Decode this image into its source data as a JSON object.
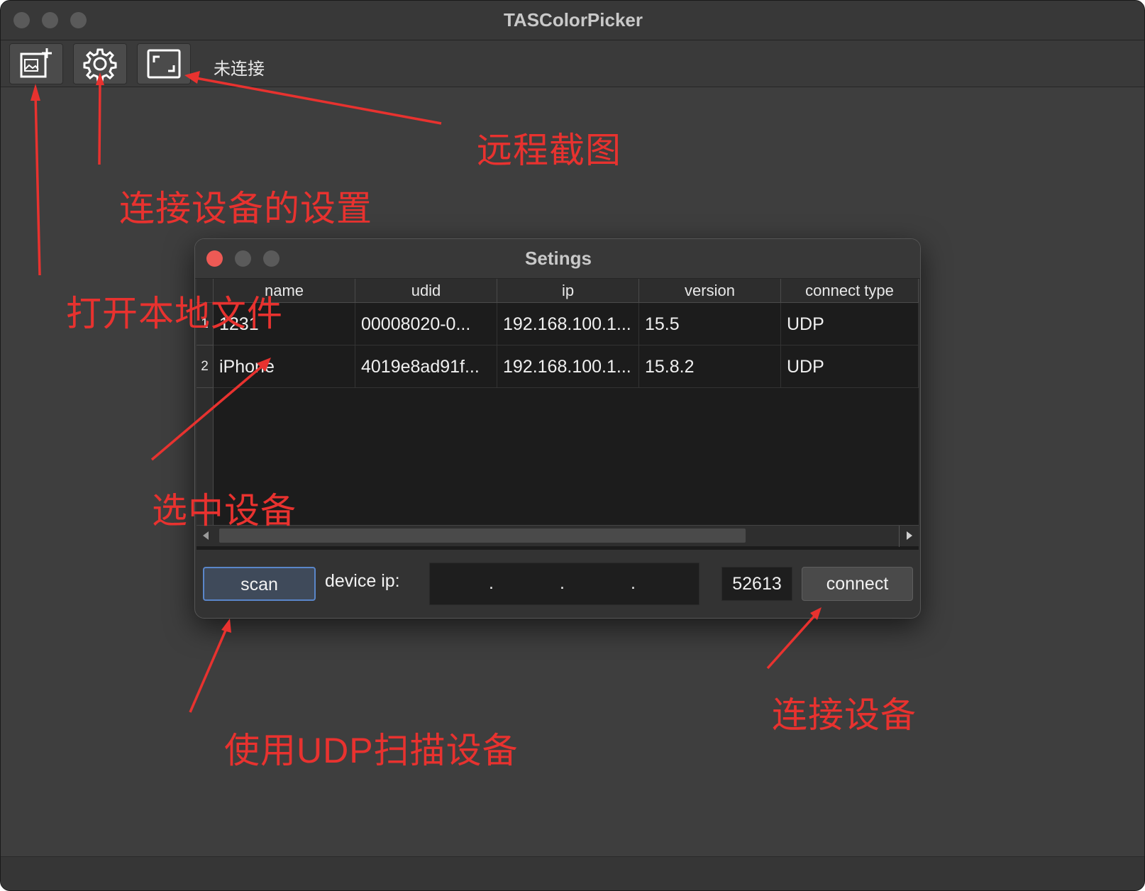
{
  "window": {
    "title": "TASColorPicker"
  },
  "toolbar": {
    "status": "未连接",
    "buttons": [
      {
        "name": "open-local-file-button",
        "icon": "image-add-icon"
      },
      {
        "name": "settings-button",
        "icon": "gear-icon"
      },
      {
        "name": "remote-screenshot-button",
        "icon": "screenshot-frame-icon"
      }
    ]
  },
  "dialog": {
    "title": "Setings",
    "table": {
      "columns": [
        "name",
        "udid",
        "ip",
        "version",
        "connect type"
      ],
      "rows": [
        {
          "index": "1",
          "name": "1231",
          "udid": "00008020-0...",
          "ip": "192.168.100.1...",
          "version": "15.5",
          "connect_type": "UDP"
        },
        {
          "index": "2",
          "name": "iPhone",
          "udid": "4019e8ad91f...",
          "ip": "192.168.100.1...",
          "version": "15.8.2",
          "connect_type": "UDP"
        }
      ]
    },
    "scan_label": "scan",
    "device_ip_label": "device ip:",
    "ip_value": ". . .",
    "ip_dots": [
      ".",
      ".",
      "."
    ],
    "port": "52613",
    "connect_label": "connect"
  },
  "annotations": {
    "remote_screenshot": "远程截图",
    "device_settings": "连接设备的设置",
    "open_local_file": "打开本地文件",
    "select_device": "选中设备",
    "scan_udp": "使用UDP扫描设备",
    "connect_device": "连接设备"
  },
  "colors": {
    "annotation": "#e8322f",
    "close_red": "#ed5a55",
    "scan_focus": "#5a86c9"
  }
}
